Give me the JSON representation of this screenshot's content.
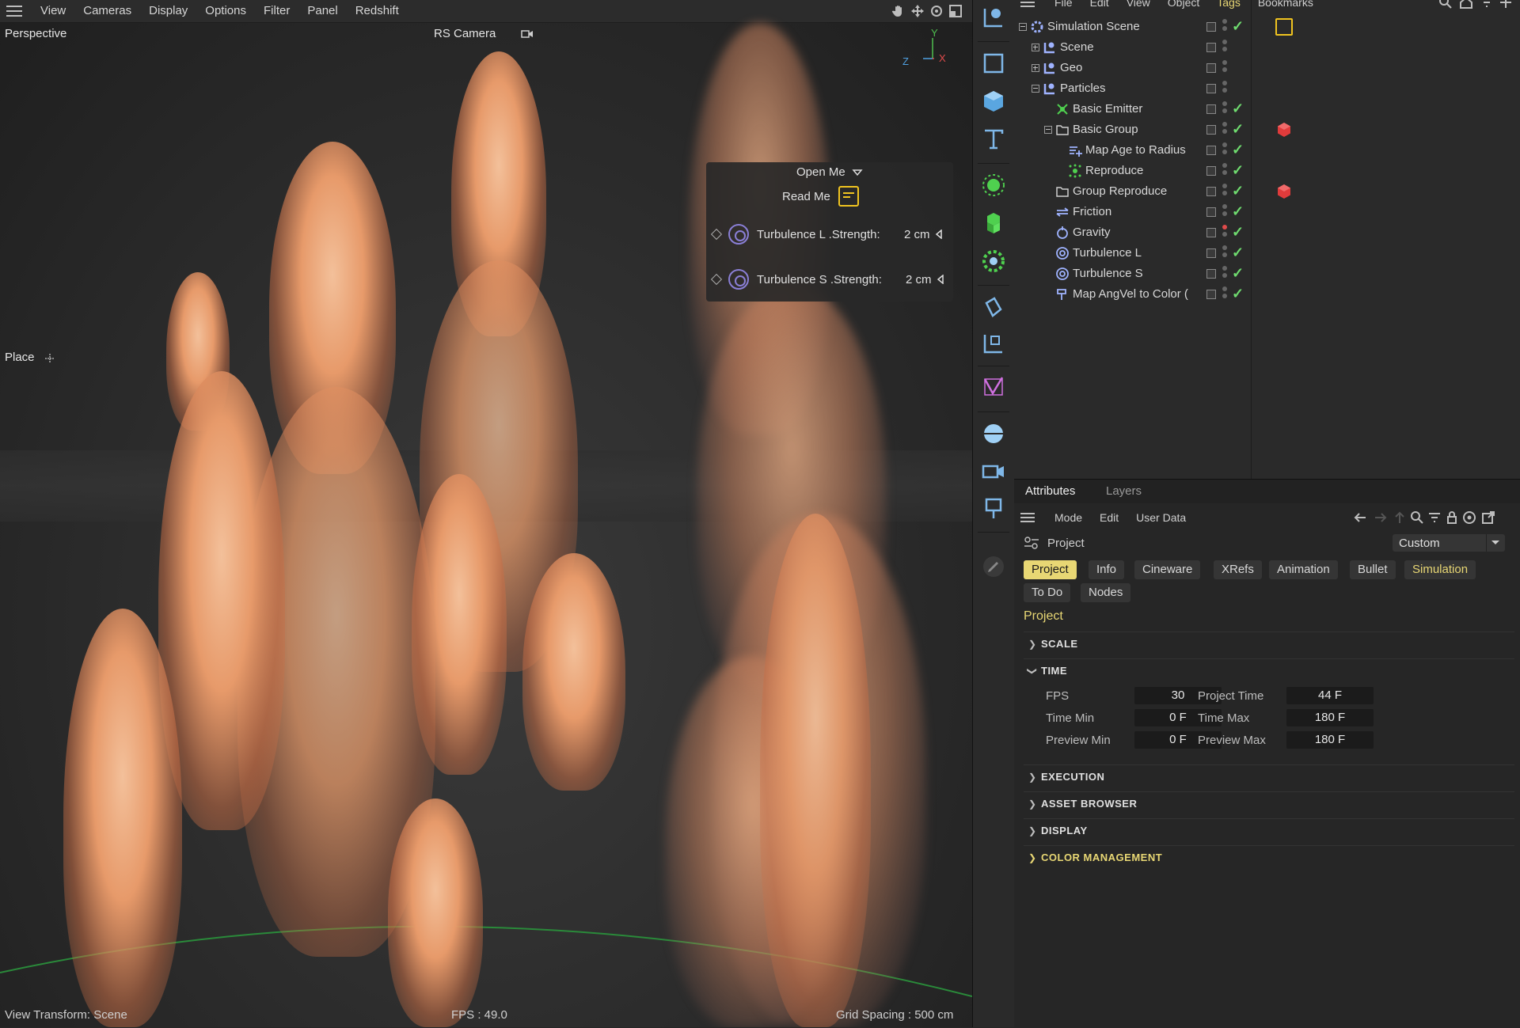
{
  "viewport": {
    "menu": [
      "View",
      "Cameras",
      "Display",
      "Options",
      "Filter",
      "Panel",
      "Redshift"
    ],
    "camera_name": "Perspective",
    "render_camera": "RS Camera",
    "place_label": "Place",
    "axis_x": "X",
    "axis_y": "Y",
    "axis_z": "Z",
    "status_left": "View Transform: Scene",
    "status_center": "FPS : 49.0",
    "status_right": "Grid Spacing : 500 cm",
    "hud": {
      "open_me": "Open Me",
      "read_me": "Read Me",
      "turb_l_label": "Turbulence L .Strength:",
      "turb_l_value": "2 cm",
      "turb_s_label": "Turbulence S .Strength:",
      "turb_s_value": "2 cm"
    }
  },
  "toolbar": {
    "tools": [
      "coordinate-system-icon",
      "rectangle-select-icon",
      "cube-icon",
      "text-icon",
      "emitter-icon",
      "cloner-icon",
      "gear-field-icon",
      "deformer-icon",
      "axis-icon",
      "spline-pen-icon",
      "sky-sphere-icon",
      "camera-icon",
      "light-icon",
      "edit-pen-icon"
    ]
  },
  "object_manager": {
    "menu": [
      "File",
      "Edit",
      "View",
      "Object",
      "Tags",
      "Bookmarks"
    ],
    "active_menu": "Tags",
    "items": [
      {
        "name": "Simulation Scene"
      },
      {
        "name": "Scene"
      },
      {
        "name": "Geo"
      },
      {
        "name": "Particles"
      },
      {
        "name": "Basic Emitter"
      },
      {
        "name": "Basic Group"
      },
      {
        "name": "Map Age to Radius"
      },
      {
        "name": "Reproduce"
      },
      {
        "name": "Group Reproduce"
      },
      {
        "name": "Friction"
      },
      {
        "name": "Gravity"
      },
      {
        "name": "Turbulence L"
      },
      {
        "name": "Turbulence S"
      },
      {
        "name": "Map AngVel to Color ("
      }
    ]
  },
  "attributes": {
    "tabs": [
      "Attributes",
      "Layers"
    ],
    "menu": [
      "Mode",
      "Edit",
      "User Data"
    ],
    "object_label": "Project",
    "preset": "Custom",
    "pills": [
      "Project",
      "Info",
      "Cineware",
      "XRefs",
      "Animation",
      "Bullet",
      "Simulation",
      "To Do",
      "Nodes"
    ],
    "section_title": "Project",
    "sections": {
      "scale": "SCALE",
      "time": "TIME",
      "execution": "EXECUTION",
      "asset_browser": "ASSET BROWSER",
      "display": "DISPLAY",
      "color_management": "COLOR MANAGEMENT"
    },
    "time": {
      "fps_label": "FPS",
      "fps": "30",
      "project_time_label": "Project Time",
      "project_time": "44 F",
      "time_min_label": "Time Min",
      "time_min": "0 F",
      "time_max_label": "Time Max",
      "time_max": "180 F",
      "preview_min_label": "Preview Min",
      "preview_min": "0 F",
      "preview_max_label": "Preview Max",
      "preview_max": "180 F"
    }
  },
  "colors": {
    "accent": "#e8d774",
    "check": "#6fdc6f",
    "tag_red": "#e03b3b",
    "particle": "#e79a6a"
  }
}
